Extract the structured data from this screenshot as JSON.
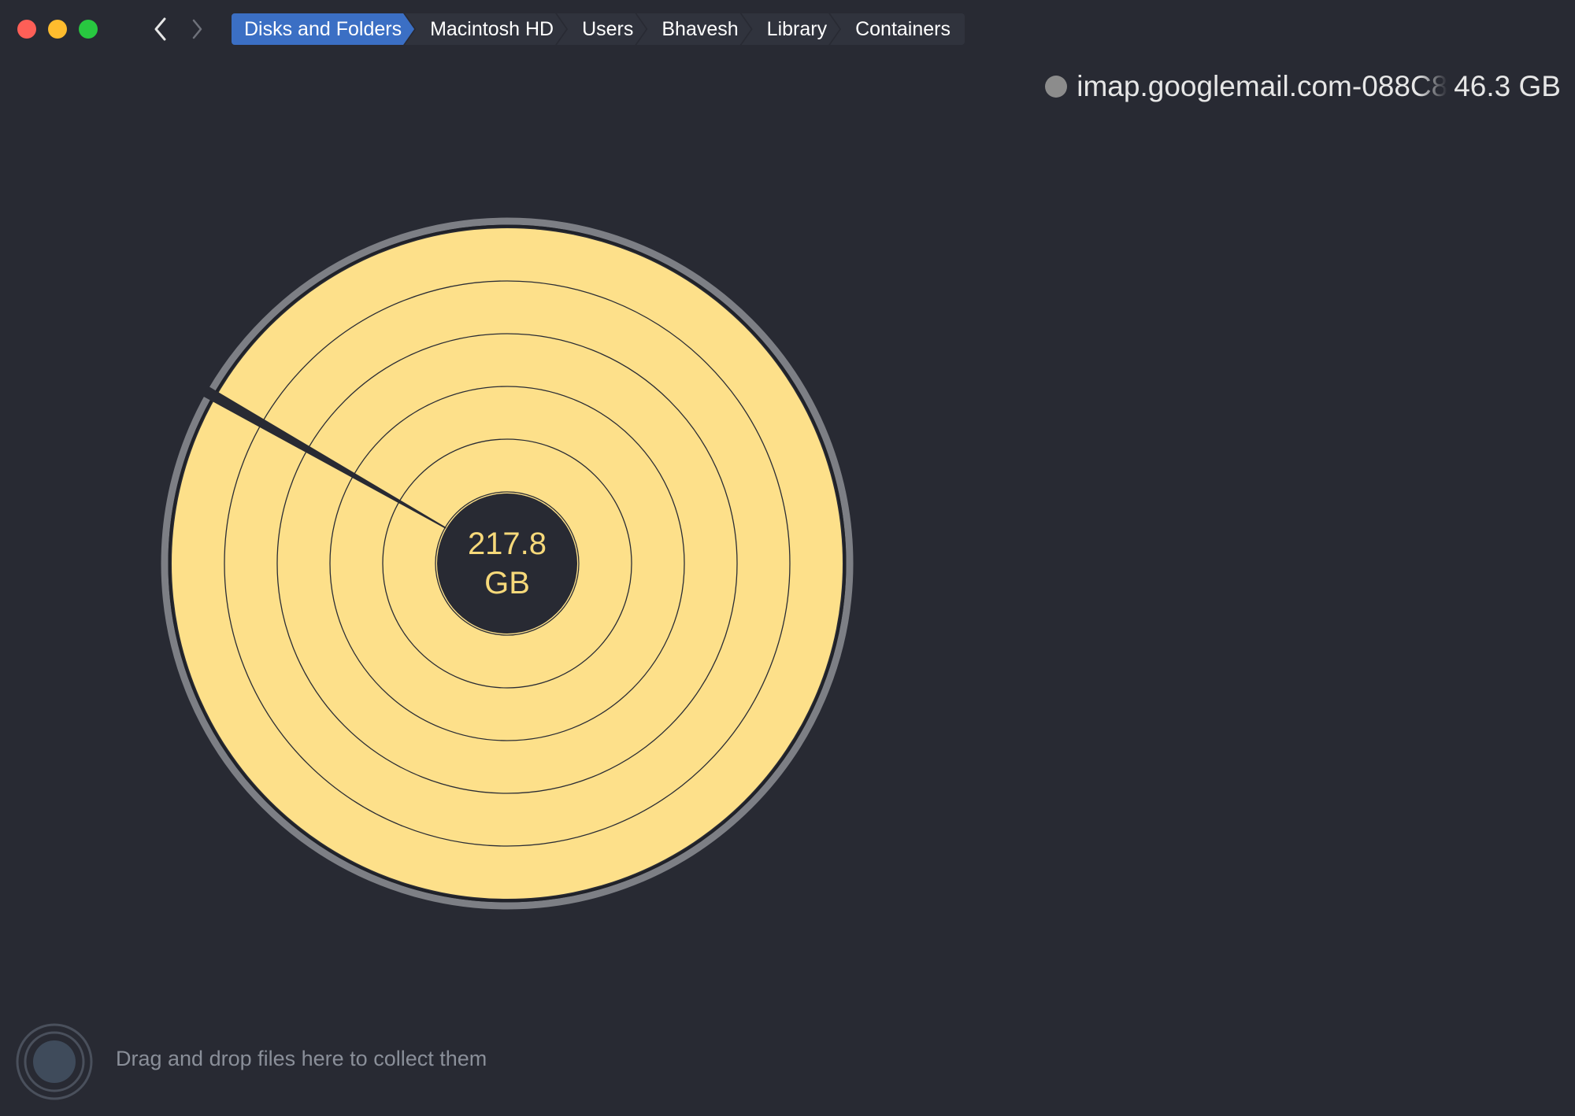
{
  "window": {
    "controls": [
      "close-button",
      "minimize-button",
      "zoom-button"
    ]
  },
  "nav": {
    "back_icon": "chevron-left-icon",
    "forward_icon": "chevron-right-icon"
  },
  "breadcrumb": {
    "items": [
      {
        "label": "Disks and Folders"
      },
      {
        "label": "Macintosh HD"
      },
      {
        "label": "Users"
      },
      {
        "label": "Bhavesh"
      },
      {
        "label": "Library"
      },
      {
        "label": "Containers"
      }
    ]
  },
  "hover_info": {
    "name": "imap.googlemail.com-088C8",
    "size": "46.3 GB",
    "dot_color": "#8c8c8c"
  },
  "sunburst": {
    "total_value": "217.8",
    "total_unit": "GB",
    "ring_count": 6,
    "fill_color": "#fde08a",
    "outline_color": "#7d7f85"
  },
  "collector": {
    "hint": "Drag and drop files here to collect them",
    "icon": "collector-icon"
  }
}
